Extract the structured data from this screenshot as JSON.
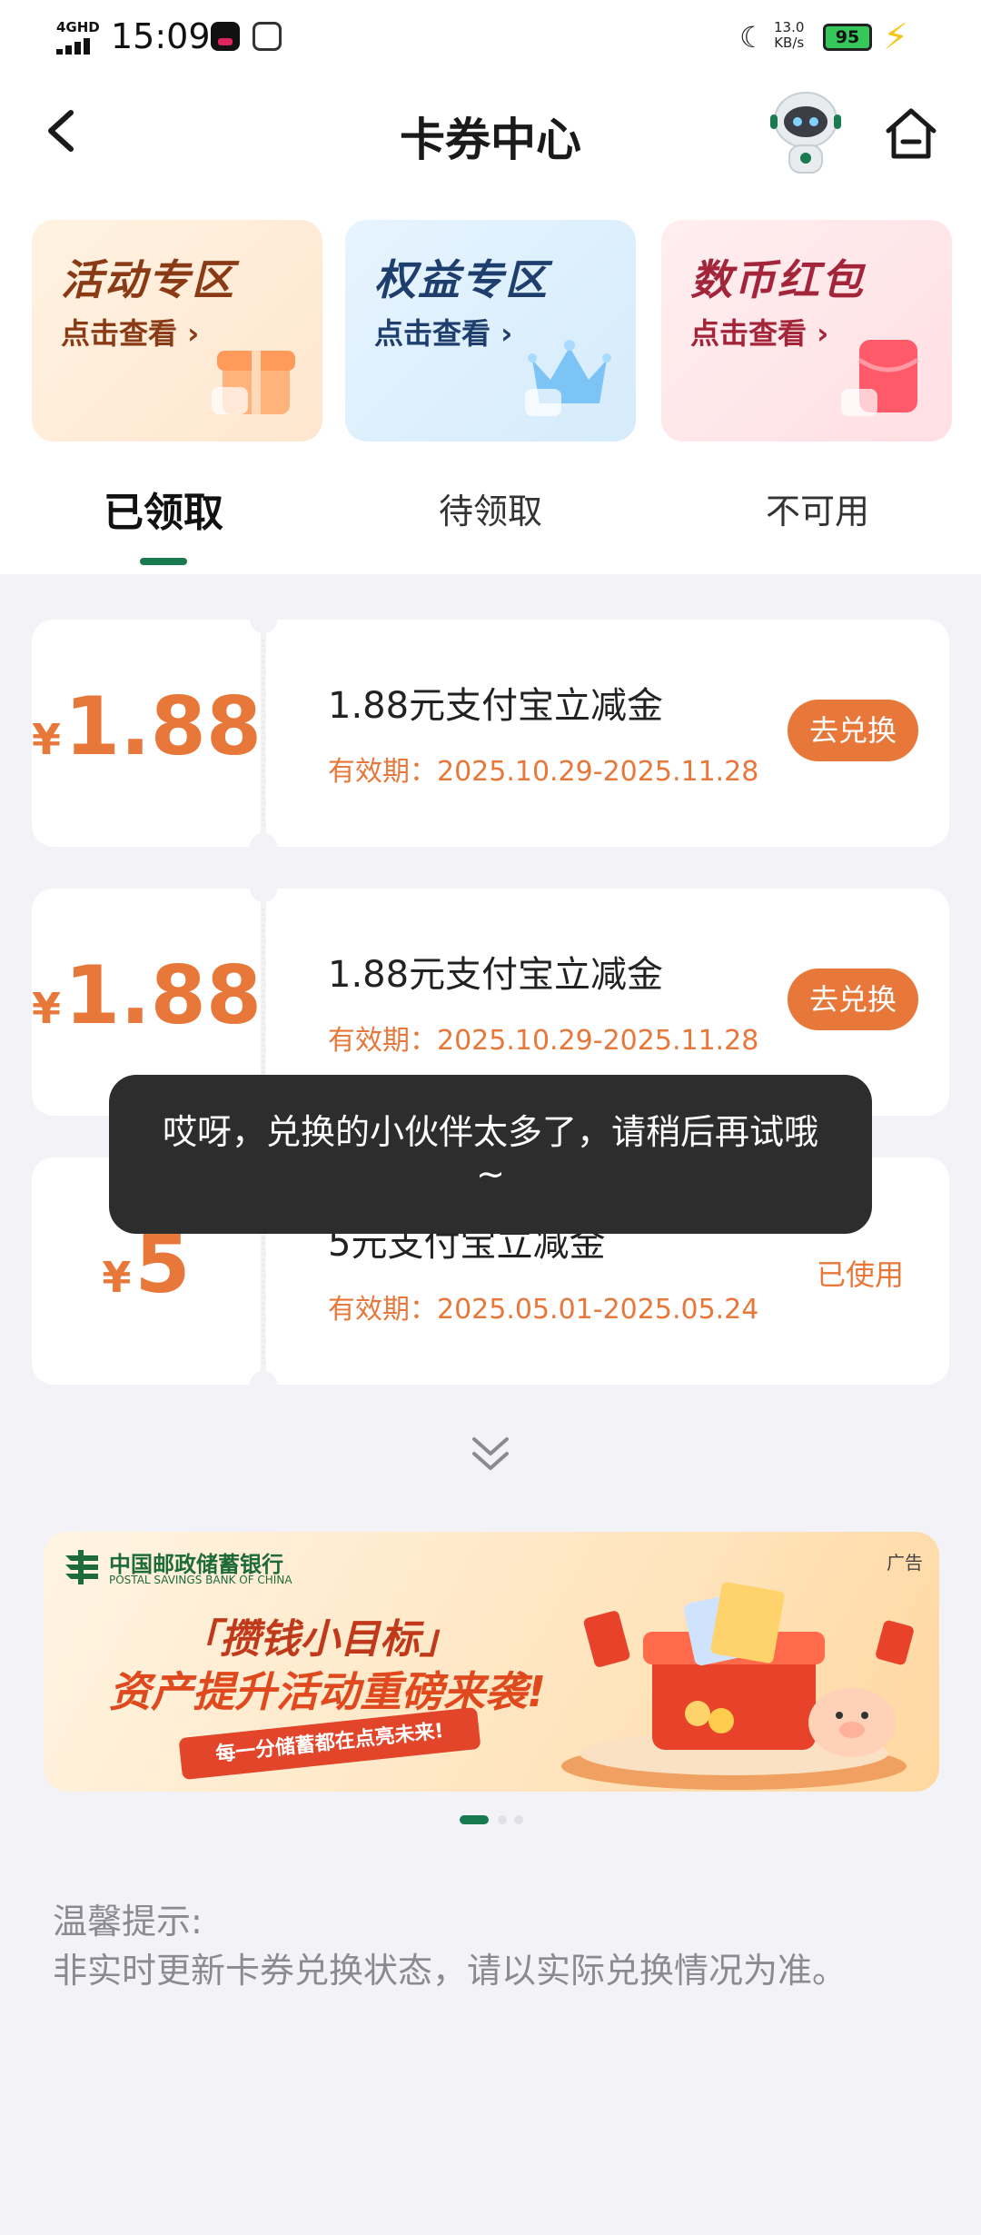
{
  "status_bar": {
    "network": "4GHD",
    "time": "15:09",
    "speed_value": "13.0",
    "speed_unit": "KB/s",
    "battery": "95"
  },
  "header": {
    "title": "卡券中心",
    "icons": [
      "back-arrow-icon",
      "robot-avatar-icon",
      "home-icon"
    ]
  },
  "promos": [
    {
      "title": "活动专区",
      "sub": "点击查看",
      "icon": "gift-box-icon"
    },
    {
      "title": "权益专区",
      "sub": "点击查看",
      "icon": "crown-icon"
    },
    {
      "title": "数币红包",
      "sub": "点击查看",
      "icon": "red-envelope-icon"
    }
  ],
  "tabs": [
    {
      "label": "已领取",
      "active": true
    },
    {
      "label": "待领取",
      "active": false
    },
    {
      "label": "不可用",
      "active": false
    }
  ],
  "coupons": [
    {
      "currency": "¥",
      "amount": "1.88",
      "name": "1.88元支付宝立减金",
      "valid": "有效期：2025.10.29-2025.11.28",
      "action": "去兑换"
    },
    {
      "currency": "¥",
      "amount": "1.88",
      "name": "1.88元支付宝立减金",
      "valid": "有效期：2025.10.29-2025.11.28",
      "action": "去兑换"
    },
    {
      "currency": "¥",
      "amount": "5",
      "name": "5元支付宝立减金",
      "valid": "有效期：2025.05.01-2025.05.24",
      "status": "已使用"
    }
  ],
  "toast": {
    "message": "哎呀，兑换的小伙伴太多了，请稍后再试哦~"
  },
  "banner": {
    "bank_name": "中国邮政储蓄银行",
    "bank_name_en": "POSTAL SAVINGS BANK OF CHINA",
    "ad_label": "广告",
    "headline_1": "「攒钱小目标」",
    "headline_2": "资产提升活动重磅来袭!",
    "ribbon": "每一分储蓄都在点亮未来!",
    "pages": 3,
    "current_page": 1
  },
  "tips": {
    "title": "温馨提示:",
    "text": "非实时更新卡券兑换状态，请以实际兑换情况为准。"
  },
  "colors": {
    "accent_orange": "#e8773a",
    "brand_green": "#1a7a4f",
    "background": "#f2f2f7"
  }
}
